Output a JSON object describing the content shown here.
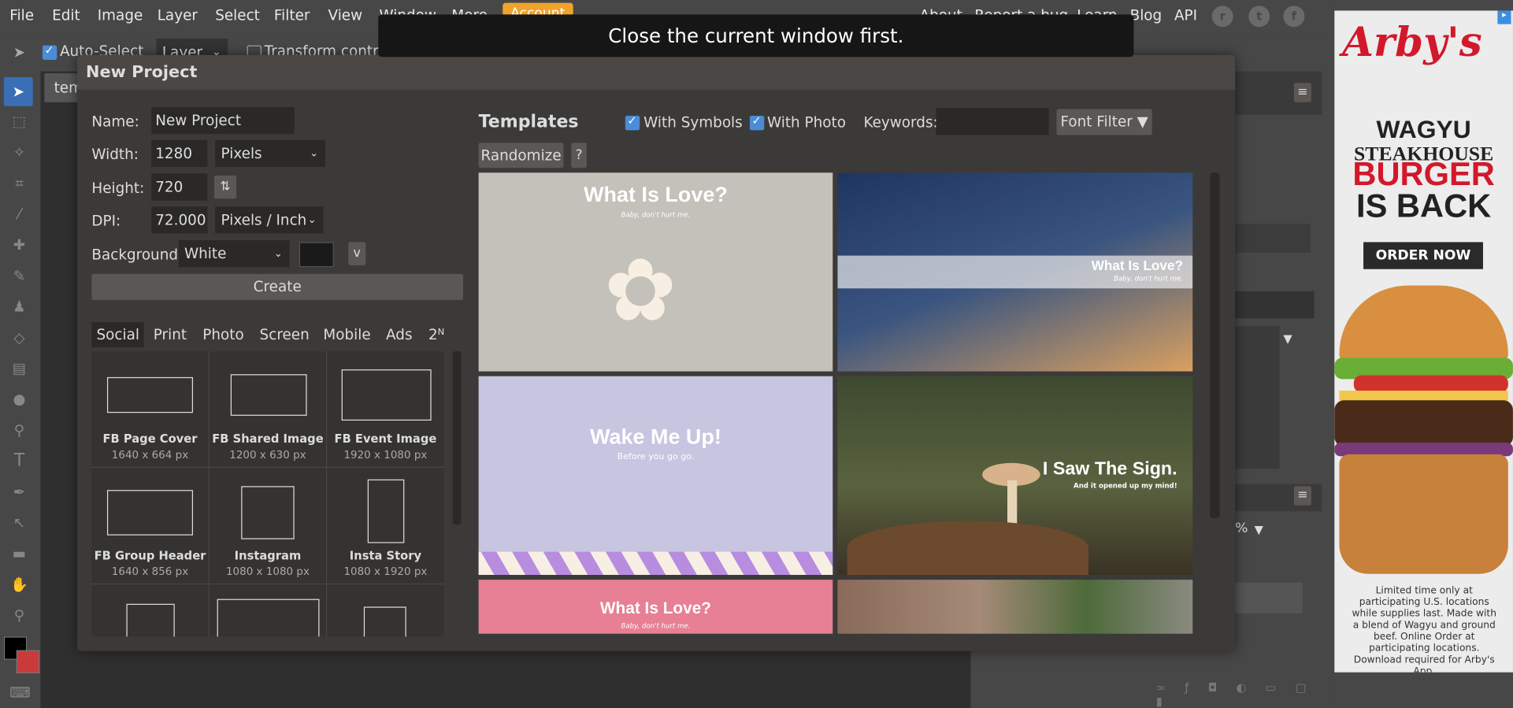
{
  "menubar": {
    "items": [
      "File",
      "Edit",
      "Image",
      "Layer",
      "Select",
      "Filter",
      "View",
      "Window",
      "More"
    ],
    "account": "Account",
    "right_links": [
      "About",
      "Report a bug",
      "Learn",
      "Blog",
      "API"
    ],
    "social_icons": [
      "reddit-icon",
      "twitter-icon",
      "facebook-icon"
    ]
  },
  "options_bar": {
    "auto_select_label": "Auto-Select",
    "auto_select_checked": true,
    "auto_select_target": "Layer",
    "transform_label": "Transform controls",
    "transform_checked": false
  },
  "workspace": {
    "doc_tab": "tem"
  },
  "toast": {
    "message": "Close the current window first."
  },
  "dialog": {
    "title": "New Project",
    "name_label": "Name:",
    "name_value": "New Project",
    "width_label": "Width:",
    "width_value": "1280",
    "width_unit": "Pixels",
    "height_label": "Height:",
    "height_value": "720",
    "dpi_label": "DPI:",
    "dpi_value": "72.000",
    "dpi_unit": "Pixels / Inch",
    "background_label": "Background:",
    "background_value": "White",
    "background_color": "#1a1a1a",
    "v_button": "v",
    "create_button": "Create",
    "category_tabs": [
      "Social",
      "Print",
      "Photo",
      "Screen",
      "Mobile",
      "Ads",
      "2ᴺ"
    ],
    "active_category": "Social",
    "presets": [
      {
        "name": "FB Page Cover",
        "size": "1640 x 664 px"
      },
      {
        "name": "FB Shared Image",
        "size": "1200 x 630 px"
      },
      {
        "name": "FB Event Image",
        "size": "1920 x 1080 px"
      },
      {
        "name": "FB Group Header",
        "size": "1640 x 856 px"
      },
      {
        "name": "Instagram",
        "size": "1080 x 1080 px"
      },
      {
        "name": "Insta Story",
        "size": "1080 x 1920 px"
      }
    ],
    "templates": {
      "heading": "Templates",
      "with_symbols_label": "With Symbols",
      "with_symbols_checked": true,
      "with_photo_label": "With Photo",
      "with_photo_checked": true,
      "keywords_label": "Keywords:",
      "keywords_value": "",
      "font_filter": "Font Filter ▼",
      "randomize": "Randomize",
      "help": "?",
      "cards": [
        {
          "title": "What Is Love?",
          "subtitle": "Baby, don't hurt me.",
          "bg": "#c4c0ba"
        },
        {
          "title": "What Is Love?",
          "subtitle": "Baby, don't hurt me.",
          "bg": "#3a5580"
        },
        {
          "title": "Wake Me Up!",
          "subtitle": "Before you go go.",
          "bg": "#c7c5e0"
        },
        {
          "title": "I Saw The Sign.",
          "subtitle": "And it opened up my mind!",
          "bg": "#4a4f35"
        },
        {
          "title": "What Is Love?",
          "subtitle": "Baby, don't hurt me.",
          "bg": "#e77f95"
        },
        {
          "title": "",
          "subtitle": "",
          "bg": "#8a7a6a"
        }
      ]
    }
  },
  "ad": {
    "brand": "Arby's",
    "line1": "WAGYU",
    "line2": "STEAKHOUSE",
    "line3": "BURGER",
    "line4": "IS BACK",
    "cta": "ORDER NOW",
    "fine_print": "Limited time only at participating U.S. locations while supplies last. Made with a blend of Wagyu and ground beef. Online Order at participating locations. Download required for Arby's App.",
    "brand_color": "#d2182b"
  }
}
